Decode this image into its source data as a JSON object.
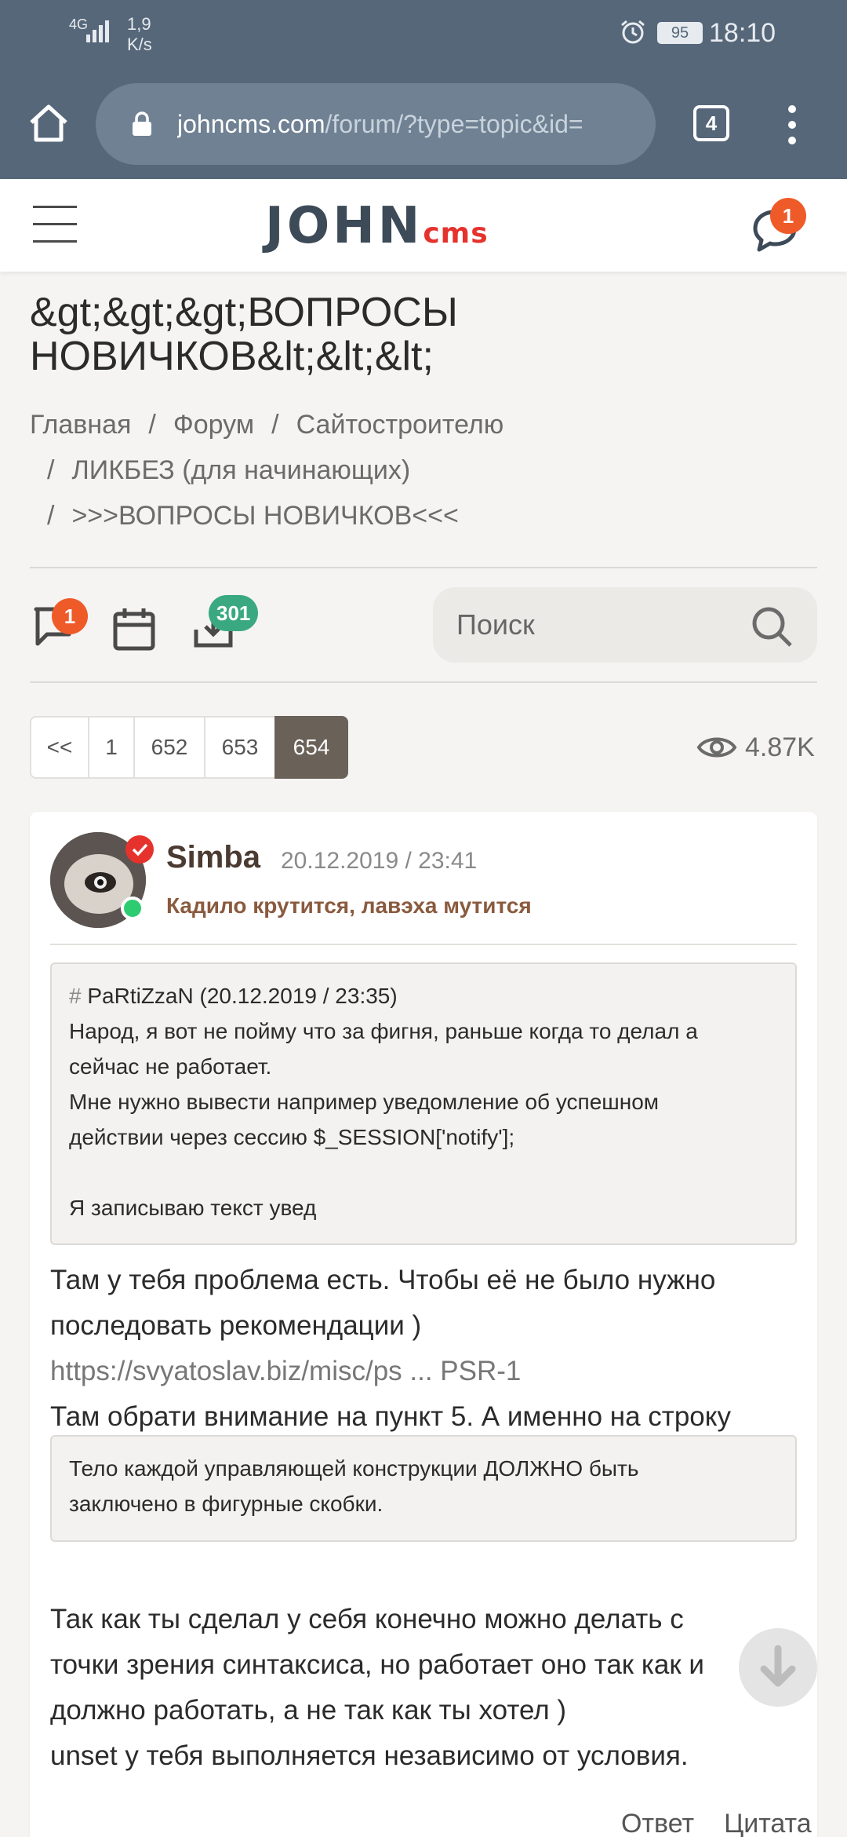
{
  "status_bar": {
    "network": "4G",
    "speed": "1,9",
    "speed_unit": "K/s",
    "battery": "95",
    "time": "18:10"
  },
  "browser": {
    "url_domain": "johncms.com",
    "url_path": "/forum/?type=topic&id=",
    "tab_count": "4",
    "icons": [
      "home-icon",
      "lock-icon",
      "tabs-icon",
      "more-icon"
    ]
  },
  "site": {
    "logo_main": "JOHN",
    "logo_sub": "cms",
    "chat_badge": "1",
    "logo_colors": {
      "main": "#3d4a57",
      "sub": "#e5322d"
    }
  },
  "page": {
    "title_line1": "&gt;&gt;&gt;ВОПРОСЫ",
    "title_line2": "НОВИЧКОВ&lt;&lt;&lt;",
    "breadcrumb": {
      "home": "Главная",
      "forum": "Форум",
      "section": "Сайтостроителю",
      "subsection": "ЛИКБЕЗ (для начинающих)",
      "topic": ">>>ВОПРОСЫ НОВИЧКОВ<<<",
      "separator": "/"
    }
  },
  "toolbar": {
    "messages_badge": "1",
    "downloads_badge": "301",
    "search_placeholder": "Поиск",
    "accent_colors": {
      "badge_orange": "#ef5a29",
      "badge_green": "#3aa981"
    }
  },
  "pagination": {
    "prev": "<<",
    "pages": [
      "1",
      "652",
      "653",
      "654"
    ],
    "active_page": "654",
    "views": "4.87K"
  },
  "post": {
    "author": "Simba",
    "date": "20.12.2019 / 23:41",
    "status": "Кадило крутится, лавэха мутится",
    "quote1": {
      "hash": "#",
      "header": "PaRtiZzaN (20.12.2019 / 23:35)",
      "line1": "Народ, я вот не пойму что за фигня, раньше когда то делал а",
      "line2": "сейчас не работает.",
      "line3": "Мне нужно вывести например уведомление об успешном",
      "line4": "действии через сессию $_SESSION['notify'];",
      "line5": "Я записываю текст увед"
    },
    "text1_line1": "Там у тебя проблема есть. Чтобы её не было нужно",
    "text1_line2": "последовать рекомендации )",
    "link": "https://svyatoslav.biz/misc/ps ... PSR-1",
    "text2": "Там обрати внимание на пункт 5. А именно на строку",
    "quote2": {
      "line1": "Тело каждой управляющей конструкции ДОЛЖНО быть",
      "line2": "заключено в фигурные скобки."
    },
    "text3_line1": "Так как ты сделал у себя конечно можно делать с",
    "text3_line2": "точки зрения синтаксиса, но работает оно так как и",
    "text3_line3": "должно работать, а не так как ты хотел )",
    "text3_line4": "unset у тебя выполняется независимо от условия.",
    "reply": "Ответ",
    "cite": "Цитата"
  }
}
